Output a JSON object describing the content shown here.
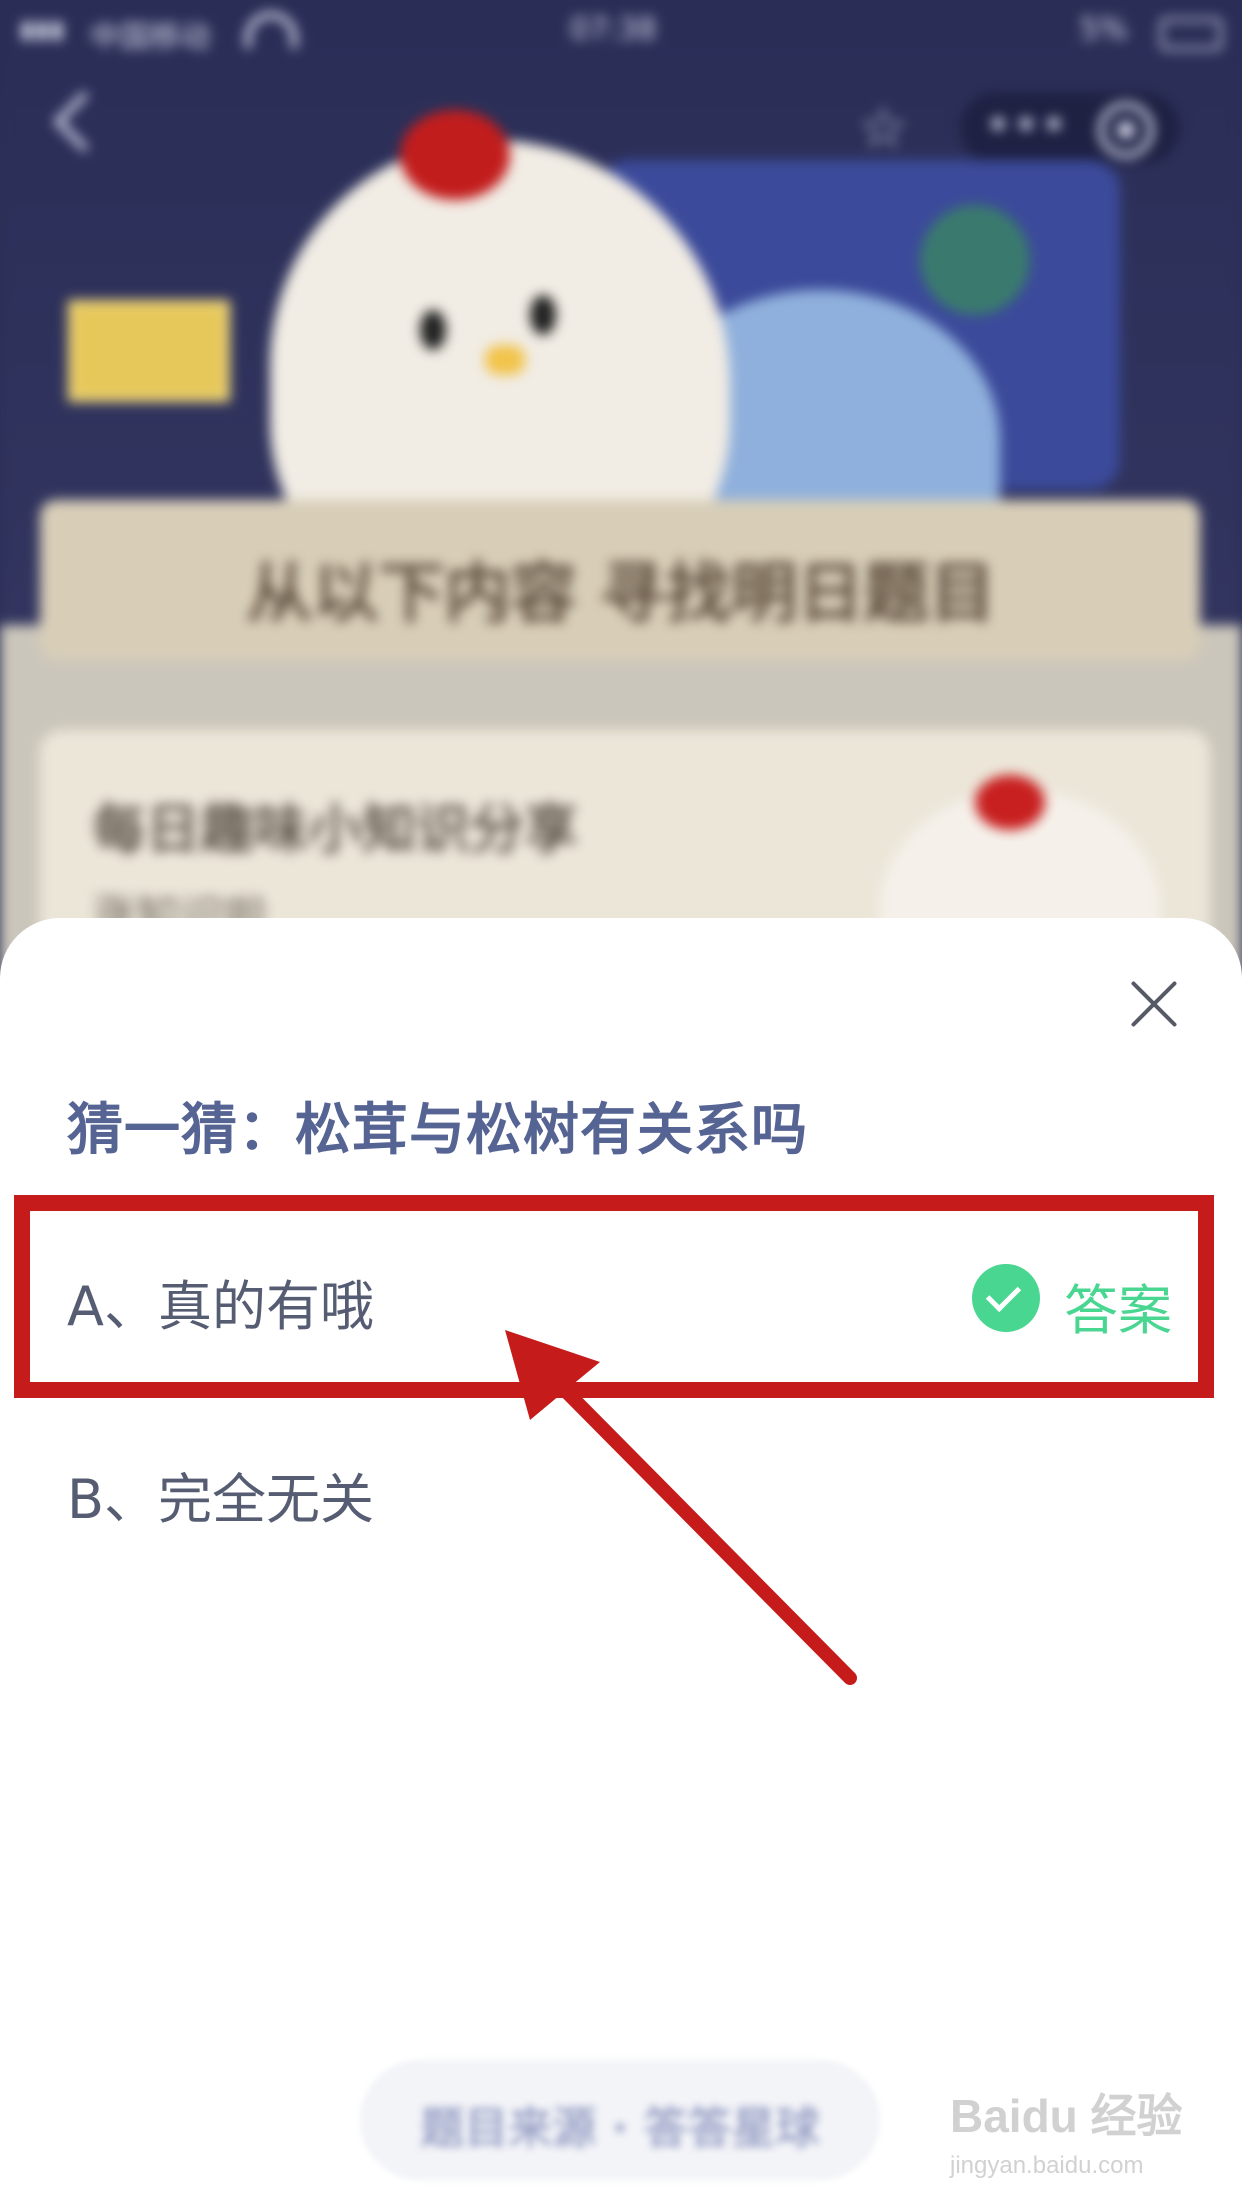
{
  "status_bar": {
    "carrier": "中国移动",
    "time": "07:38",
    "battery": "5%"
  },
  "background": {
    "banner_text": "从以下内容 寻找明日题目",
    "info_title": "每日趣味小知识分享",
    "info_subtitle": "涨知识啦"
  },
  "quiz": {
    "question": "猜一猜：松茸与松树有关系吗",
    "options": [
      {
        "label": "A、真的有哦",
        "is_answer": true
      },
      {
        "label": "B、完全无关",
        "is_answer": false
      }
    ],
    "answer_badge": "答案"
  },
  "footer": {
    "button_text": "题目来源 · 答答星球"
  },
  "watermark": {
    "main": "Baidu 经验",
    "sub": "jingyan.baidu.com"
  },
  "colors": {
    "question": "#566493",
    "answer_green": "#48d690",
    "highlight_red": "#c51b1a"
  }
}
